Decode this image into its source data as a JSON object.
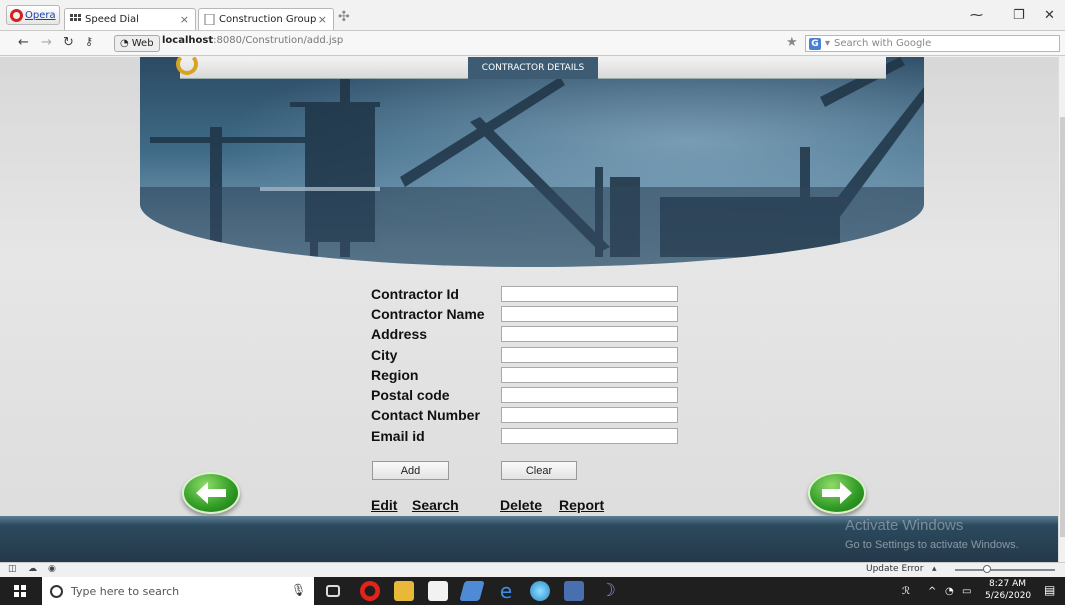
{
  "browser": {
    "opera_label": "Opera",
    "tabs": [
      {
        "label": "Speed Dial"
      },
      {
        "label": "Construction Group"
      }
    ],
    "web_badge": "Web",
    "url_host": "localhost",
    "url_path": ":8080/Constrution/add.jsp",
    "search_placeholder": "Search with Google"
  },
  "page": {
    "banner_title": "CONTRACTOR DETAILS",
    "fields": [
      {
        "label": "Contractor Id",
        "value": ""
      },
      {
        "label": "Contractor Name",
        "value": ""
      },
      {
        "label": "Address",
        "value": ""
      },
      {
        "label": "City",
        "value": ""
      },
      {
        "label": "Region",
        "value": ""
      },
      {
        "label": "Postal code",
        "value": ""
      },
      {
        "label": "Contact Number",
        "value": ""
      },
      {
        "label": "Email id",
        "value": ""
      }
    ],
    "add_label": "Add",
    "clear_label": "Clear",
    "links": {
      "edit": "Edit",
      "search": "Search",
      "delete": "Delete",
      "report": "Report"
    },
    "colors": {
      "banner_dark": "#2c4a63",
      "footer": "#2c4a5e",
      "arrow_green": "#2f9a24"
    }
  },
  "watermark": {
    "title": "Activate Windows",
    "subtitle": "Go to Settings to activate Windows."
  },
  "statusbar": {
    "update_error": "Update Error"
  },
  "taskbar": {
    "search_placeholder": "Type here to search",
    "time": "8:27 AM",
    "date": "5/26/2020"
  }
}
